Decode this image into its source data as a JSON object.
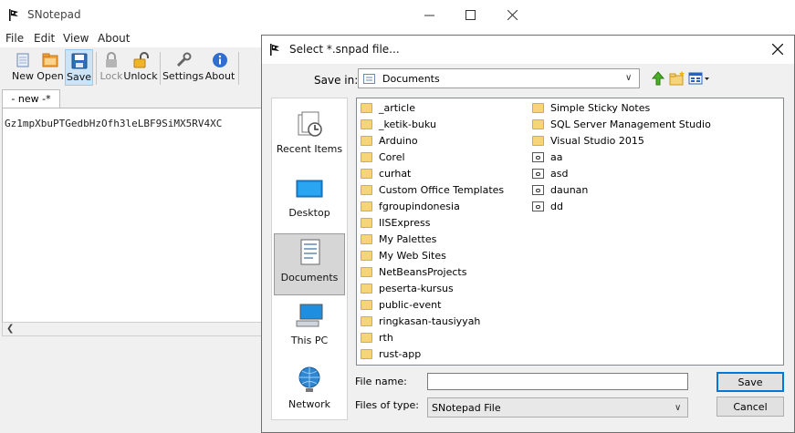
{
  "main": {
    "title": "SNotepad",
    "menu": [
      "File",
      "Edit",
      "View",
      "About"
    ],
    "toolbar": {
      "new": "New",
      "open": "Open",
      "save": "Save",
      "lock": "Lock",
      "unlock": "Unlock",
      "settings": "Settings",
      "about": "About"
    },
    "tab": "- new -*",
    "editor_text": "Gz1mpXbuPTGedbHzOfh3leLBF9SiMX5RV4XC"
  },
  "dialog": {
    "title": "Select *.snpad file...",
    "save_in_label": "Save in:",
    "save_in_value": "Documents",
    "places": [
      "Recent Items",
      "Desktop",
      "Documents",
      "This PC",
      "Network"
    ],
    "selected_place": "Documents",
    "files_col1": [
      "_article",
      "_ketik-buku",
      "Arduino",
      "Corel",
      "curhat",
      "Custom Office Templates",
      "fgroupindonesia",
      "IISExpress",
      "My Palettes",
      "My Web Sites",
      "NetBeansProjects",
      "peserta-kursus",
      "public-event",
      "ringkasan-tausiyyah",
      "rth",
      "rust-app"
    ],
    "files_col2": [
      {
        "name": "Simple Sticky Notes",
        "type": "folder"
      },
      {
        "name": "SQL Server Management Studio",
        "type": "folder"
      },
      {
        "name": "Visual Studio 2015",
        "type": "folder"
      },
      {
        "name": "aa",
        "type": "file"
      },
      {
        "name": "asd",
        "type": "file"
      },
      {
        "name": "daunan",
        "type": "file"
      },
      {
        "name": "dd",
        "type": "file"
      }
    ],
    "file_name_label": "File name:",
    "file_name_value": "",
    "file_type_label": "Files of type:",
    "file_type_value": "SNotepad File",
    "save_button": "Save",
    "cancel_button": "Cancel"
  },
  "colors": {
    "folder": "#f7d47a",
    "accent": "#0078d7",
    "selected_place": "#d6d6d6"
  }
}
